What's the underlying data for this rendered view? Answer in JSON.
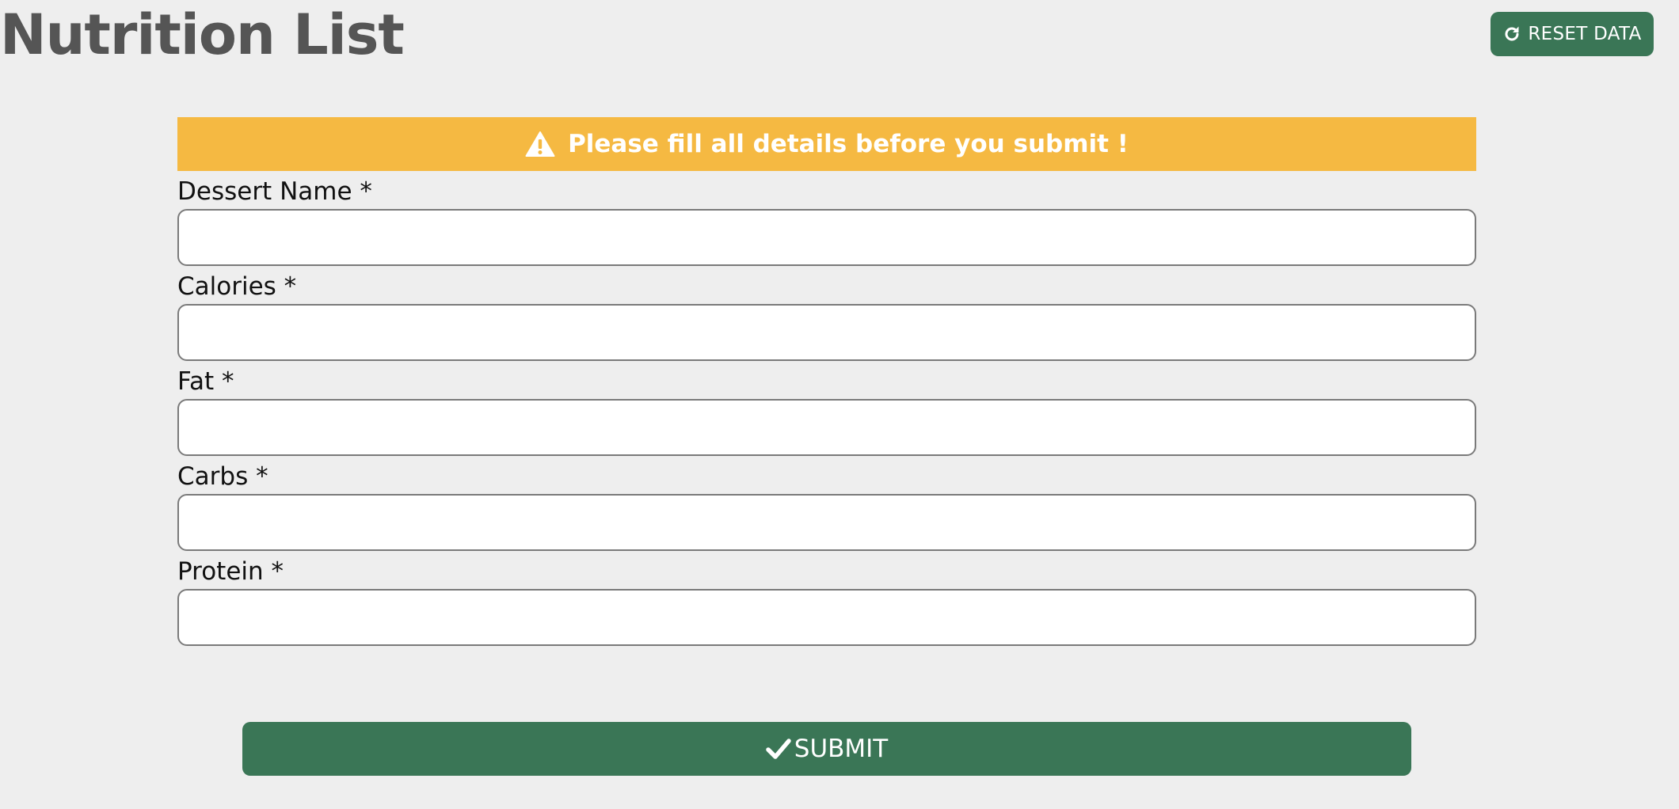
{
  "header": {
    "title": "Nutrition List",
    "reset_label": "RESET DATA",
    "reset_icon": "redo-icon"
  },
  "alert": {
    "icon": "warning-icon",
    "message": "Please fill all details before you submit !",
    "color": "#f5b942"
  },
  "form": {
    "fields": [
      {
        "label": "Dessert Name *",
        "value": "",
        "placeholder": ""
      },
      {
        "label": "Calories *",
        "value": "",
        "placeholder": ""
      },
      {
        "label": "Fat *",
        "value": "",
        "placeholder": ""
      },
      {
        "label": "Carbs *",
        "value": "",
        "placeholder": ""
      },
      {
        "label": "Protein *",
        "value": "",
        "placeholder": ""
      }
    ],
    "submit_label": "SUBMIT",
    "submit_icon": "checkmark-icon"
  },
  "colors": {
    "background": "#eeeeee",
    "primary_button": "#3a7656",
    "warning": "#f5b942",
    "title": "#555555"
  }
}
